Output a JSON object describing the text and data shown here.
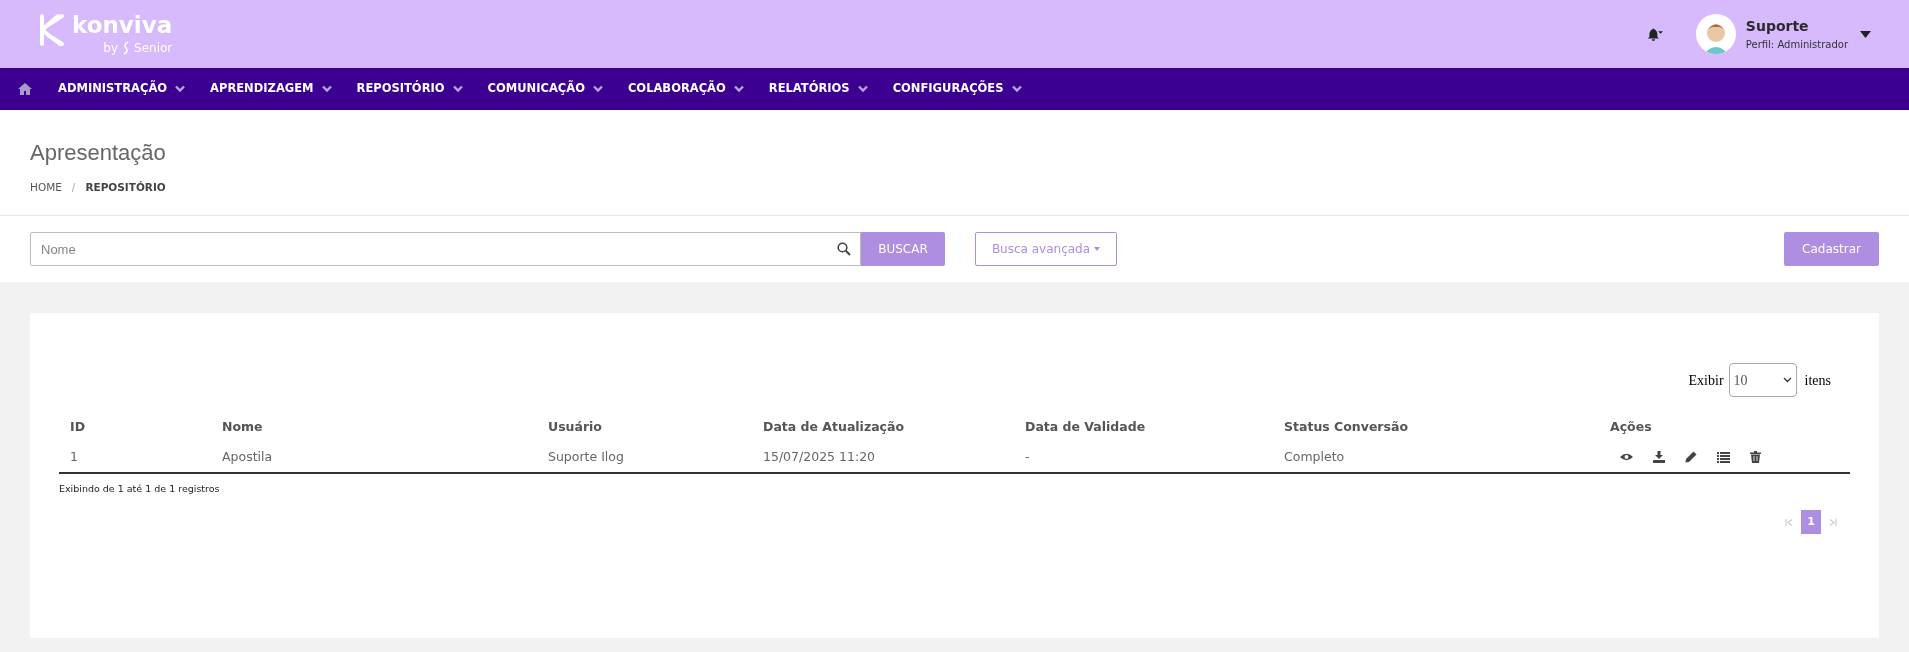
{
  "header": {
    "logo": {
      "name": "konviva",
      "tagline": "by",
      "brand": "Senior"
    },
    "user": {
      "name": "Suporte",
      "profile": "Perfil: Administrador"
    }
  },
  "nav": [
    {
      "label": "ADMINISTRAÇÃO"
    },
    {
      "label": "APRENDIZAGEM"
    },
    {
      "label": "REPOSITÓRIO"
    },
    {
      "label": "COMUNICAÇÃO"
    },
    {
      "label": "COLABORAÇÃO"
    },
    {
      "label": "RELATÓRIOS"
    },
    {
      "label": "CONFIGURAÇÕES"
    }
  ],
  "page": {
    "title": "Apresentação",
    "breadcrumb": [
      {
        "label": "HOME",
        "current": false
      },
      {
        "label": "REPOSITÓRIO",
        "current": true
      }
    ],
    "breadcrumb_separator": "/"
  },
  "search": {
    "placeholder": "Nome",
    "button": "BUSCAR",
    "advanced": "Busca avançada",
    "create": "Cadastrar"
  },
  "page_size": {
    "before": "Exibir",
    "value": "10",
    "after": "itens"
  },
  "table": {
    "columns": [
      "ID",
      "Nome",
      "Usuário",
      "Data de Atualização",
      "Data de Validade",
      "Status Conversão",
      "Ações"
    ],
    "rows": [
      {
        "cells": [
          "1",
          "Apostila",
          "Suporte Ilog",
          "15/07/2025 11:20",
          "-",
          "Completo"
        ],
        "actions": [
          {
            "kind": "view"
          },
          {
            "kind": "download"
          },
          {
            "kind": "edit"
          },
          {
            "kind": "list"
          },
          {
            "kind": "delete"
          }
        ]
      }
    ]
  },
  "info": "Exibindo de 1 até 1 de 1 registros",
  "pagination": {
    "pages": [
      {
        "label": "1",
        "selected": true
      }
    ]
  }
}
